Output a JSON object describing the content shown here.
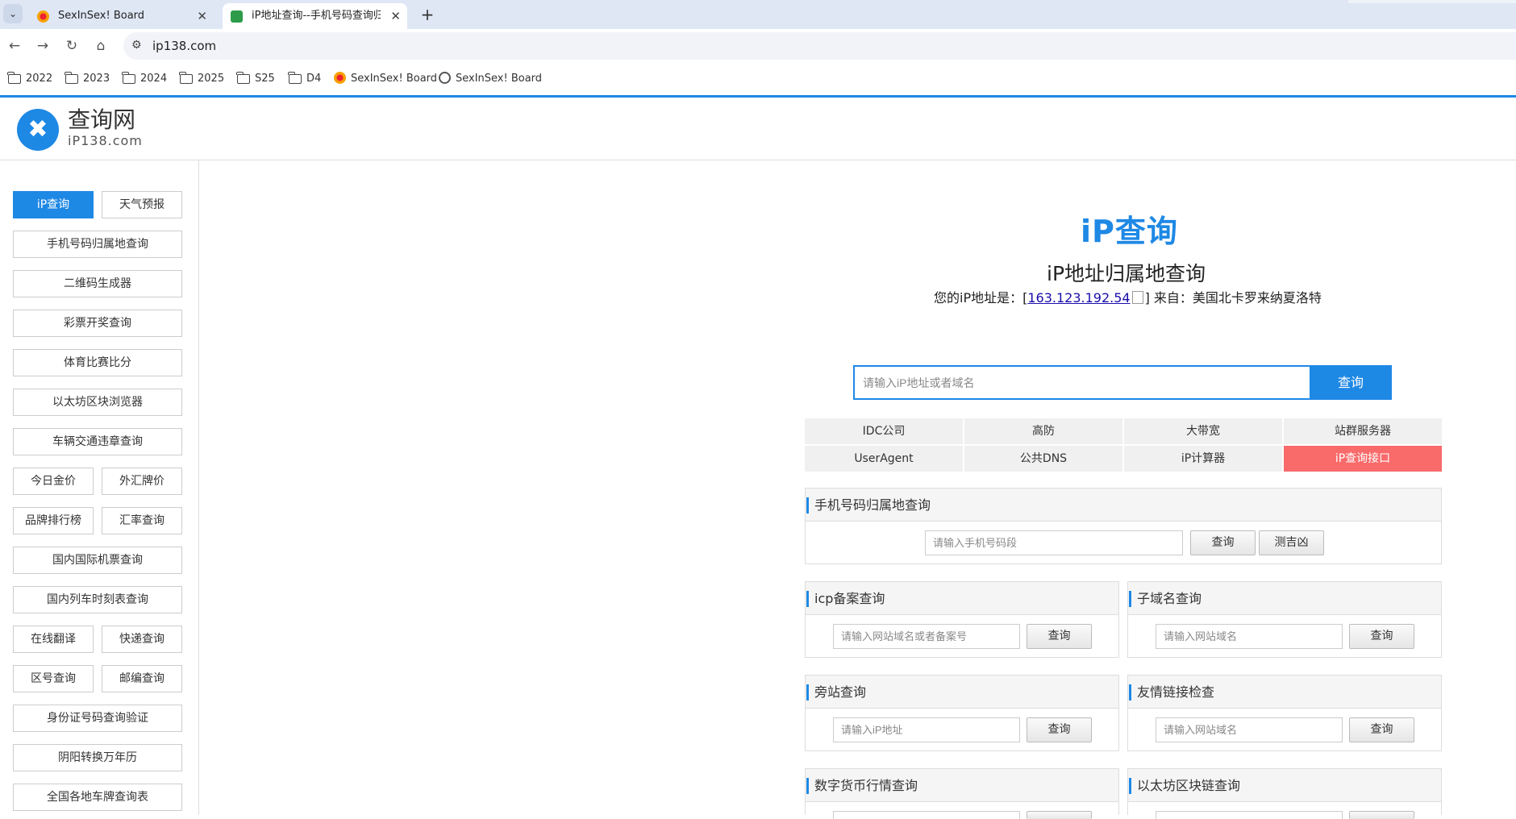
{
  "browser": {
    "tabs": [
      {
        "title": "SexInSex! Board"
      },
      {
        "title": "iP地址查询--手机号码查询归属"
      }
    ],
    "url": "ip138.com",
    "bookmarks": [
      "2022",
      "2023",
      "2024",
      "2025",
      "S25",
      "D4",
      "SexInSex! Board",
      "SexInSex! Board"
    ]
  },
  "site": {
    "logo_name": "查询网",
    "logo_domain": "iP138.com"
  },
  "sidebar": {
    "items": [
      "iP查询",
      "天气预报",
      "手机号码归属地查询",
      "二维码生成器",
      "彩票开奖查询",
      "体育比赛比分",
      "以太坊区块浏览器",
      "车辆交通违章查询",
      "今日金价",
      "外汇牌价",
      "品牌排行榜",
      "汇率查询",
      "国内国际机票查询",
      "国内列车时刻表查询",
      "在线翻译",
      "快递查询",
      "区号查询",
      "邮编查询",
      "身份证号码查询验证",
      "阴阳转换万年历",
      "全国各地车牌查询表"
    ]
  },
  "main": {
    "title": "iP查询",
    "subtitle": "iP地址归属地查询",
    "ip_prefix": "您的iP地址是：[",
    "ip": "163.123.192.54",
    "ip_suffix": "] 来自：美国北卡罗来纳夏洛特",
    "search_placeholder": "请输入iP地址或者域名",
    "search_button": "查询",
    "links": [
      "IDC公司",
      "高防",
      "大带宽",
      "站群服务器",
      "UserAgent",
      "公共DNS",
      "iP计算器",
      "iP查询接口"
    ],
    "panels": {
      "phone": {
        "title": "手机号码归属地查询",
        "placeholder": "请输入手机号码段",
        "button": "查询",
        "button2": "测吉凶"
      },
      "icp": {
        "title": "icp备案查询",
        "placeholder": "请输入网站域名或者备案号",
        "button": "查询"
      },
      "subdomain": {
        "title": "子域名查询",
        "placeholder": "请输入网站域名",
        "button": "查询"
      },
      "sidesite": {
        "title": "旁站查询",
        "placeholder": "请输入iP地址",
        "button": "查询"
      },
      "friendlink": {
        "title": "友情链接检查",
        "placeholder": "请输入网站域名",
        "button": "查询"
      },
      "crypto": {
        "title": "数字货币行情查询"
      },
      "eth": {
        "title": "以太坊区块链查询"
      }
    }
  }
}
